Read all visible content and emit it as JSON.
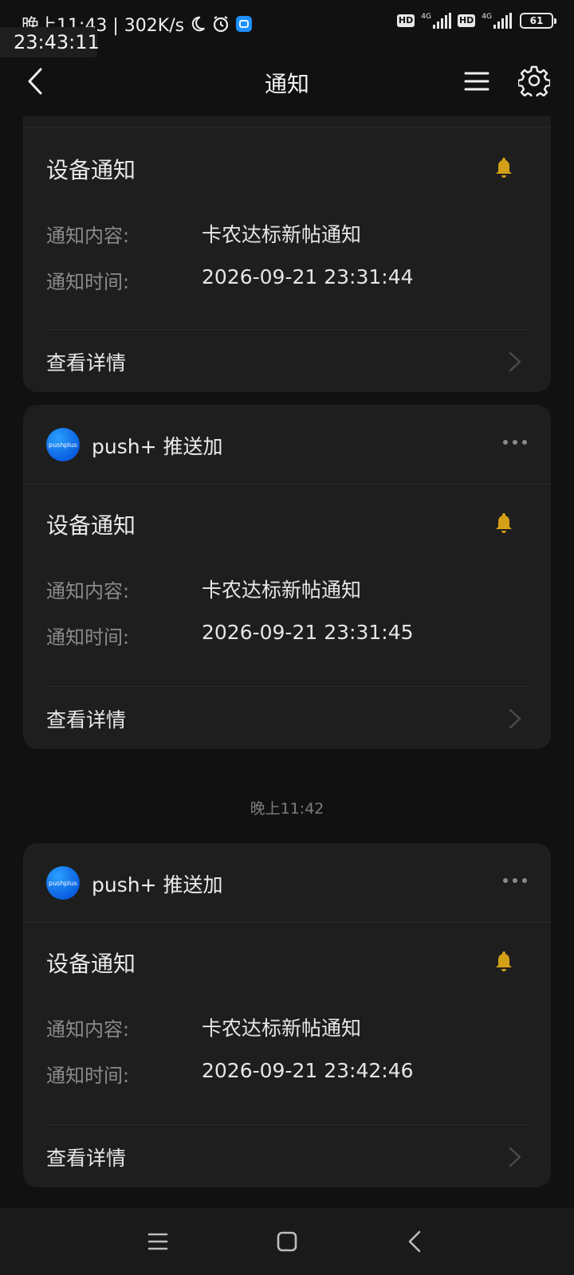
{
  "status_bar": {
    "time": "晚上11:43 | 302K/s",
    "network_1": "4G",
    "network_2": "4G",
    "hd_1": "HD",
    "hd_2": "HD",
    "battery": "61"
  },
  "clock_overlay": "23:43:11",
  "nav": {
    "title": "通知"
  },
  "cards": [
    {
      "title": "设备通知",
      "content_label": "通知内容:",
      "content_value": "卡农达标新帖通知",
      "time_label": "通知时间:",
      "time_value": "2026-09-21 23:31:44",
      "detail_label": "查看详情"
    },
    {
      "app_logo_text": "pushplus",
      "app_name": "push+ 推送加",
      "title": "设备通知",
      "content_label": "通知内容:",
      "content_value": "卡农达标新帖通知",
      "time_label": "通知时间:",
      "time_value": "2026-09-21 23:31:45",
      "detail_label": "查看详情"
    },
    {
      "app_logo_text": "pushplus",
      "app_name": "push+ 推送加",
      "title": "设备通知",
      "content_label": "通知内容:",
      "content_value": "卡农达标新帖通知",
      "time_label": "通知时间:",
      "time_value": "2026-09-21 23:42:46",
      "detail_label": "查看详情"
    }
  ],
  "time_separator": "晚上11:42",
  "colors": {
    "background": "#111111",
    "card": "#1e1e1e",
    "bell": "#d4a017",
    "logo": "#1677ff"
  },
  "icons": [
    "back-icon",
    "menu-icon",
    "settings-gear-icon",
    "bell-icon",
    "more-icon",
    "chevron-right-icon",
    "moon-icon",
    "alarm-icon",
    "app-icon",
    "home-icon"
  ]
}
